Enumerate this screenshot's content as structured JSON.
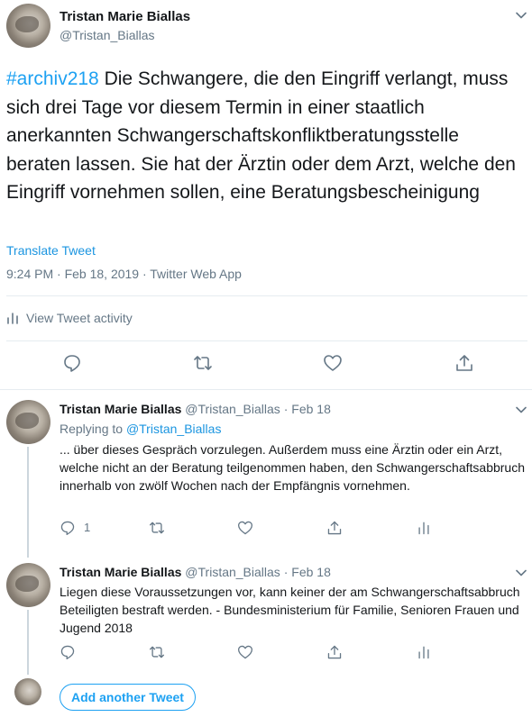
{
  "main_tweet": {
    "author_name": "Tristan Marie Biallas",
    "author_handle": "@Tristan_Biallas",
    "hashtag": "#archiv218",
    "text": " Die Schwangere, die den Eingriff verlangt, muss sich drei Tage vor diesem Termin in einer staatlich anerkannten Schwangerschaftskonfliktberatungsstelle beraten lassen. Sie hat der Ärztin oder dem Arzt, welche den Eingriff vornehmen sollen, eine Beratungsbescheinigung",
    "translate_label": "Translate Tweet",
    "timestamp": "9:24 PM · Feb 18, 2019 · Twitter Web App",
    "activity_label": "View Tweet activity"
  },
  "replies": [
    {
      "author_name": "Tristan Marie Biallas",
      "author_handle": "@Tristan_Biallas",
      "dot": "·",
      "date": "Feb 18",
      "replying_prefix": "Replying to ",
      "replying_to": "@Tristan_Biallas",
      "text": "... über dieses Gespräch vorzulegen. Außerdem muss eine Ärztin oder ein Arzt, welche nicht an der Beratung teilgenommen haben, den Schwangerschaftsabbruch innerhalb von zwölf Wochen nach der Empfängnis vornehmen.",
      "reply_count": "1"
    },
    {
      "author_name": "Tristan Marie Biallas",
      "author_handle": "@Tristan_Biallas",
      "dot": "·",
      "date": "Feb 18",
      "text": "Liegen diese Voraussetzungen vor, kann keiner der am Schwangerschaftsabbruch Beteiligten bestraft werden. - Bundesministerium für Familie, Senioren Frauen und Jugend 2018"
    }
  ],
  "compose": {
    "add_button_label": "Add another Tweet"
  },
  "icons": {
    "reply": "reply-icon",
    "retweet": "retweet-icon",
    "like": "heart-icon",
    "share": "share-icon",
    "analytics": "analytics-icon",
    "chevron": "chevron-down-icon"
  },
  "colors": {
    "accent": "#1da1f2",
    "link": "#1b95e0",
    "secondary_text": "#657786",
    "border": "#e6ecf0"
  }
}
